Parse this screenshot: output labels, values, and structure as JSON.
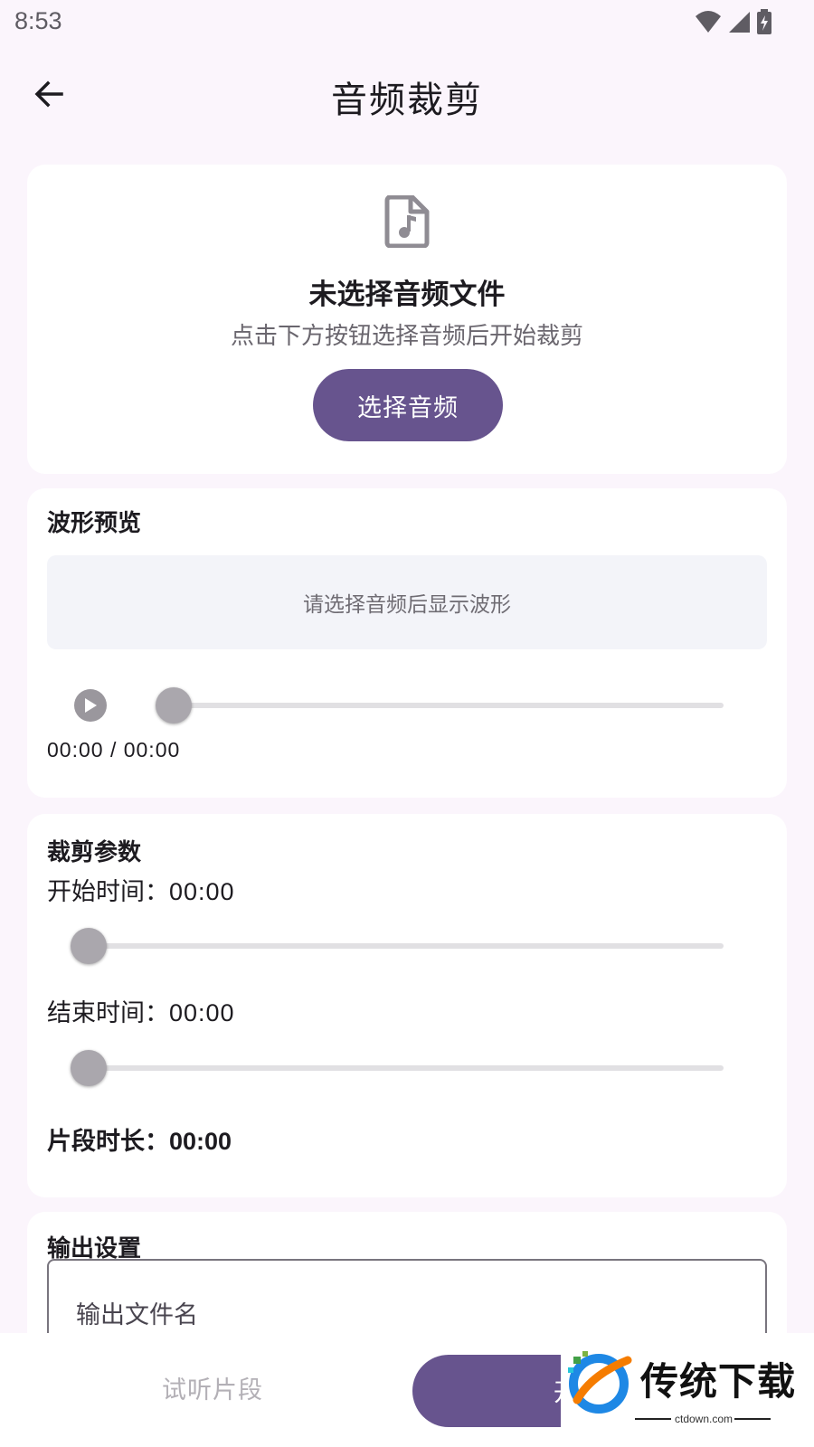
{
  "status_bar": {
    "time": "8:53"
  },
  "app_bar": {
    "title": "音频裁剪"
  },
  "file_card": {
    "headline": "未选择音频文件",
    "subtitle": "点击下方按钮选择音频后开始裁剪",
    "select_button": "选择音频"
  },
  "waveform_card": {
    "title": "波形预览",
    "placeholder": "请选择音频后显示波形",
    "time_readout": "00:00 / 00:00",
    "progress": 0
  },
  "trim_card": {
    "title": "裁剪参数",
    "start_label": "开始时间：",
    "start_value": "00:00",
    "start_fraction": 0,
    "end_label": "结束时间：",
    "end_value": "00:00",
    "end_fraction": 0,
    "duration_label": "片段时长：",
    "duration_value": "00:00"
  },
  "output_card": {
    "title": "输出设置",
    "filename_placeholder": "输出文件名"
  },
  "bottom_bar": {
    "preview_button": "试听片段",
    "start_button": "开始裁剪"
  },
  "watermark": {
    "text": "传统下载",
    "domain": "ctdown.com"
  },
  "colors": {
    "primary": "#67548e",
    "background": "#fbf5fc",
    "surface": "#ffffff"
  }
}
